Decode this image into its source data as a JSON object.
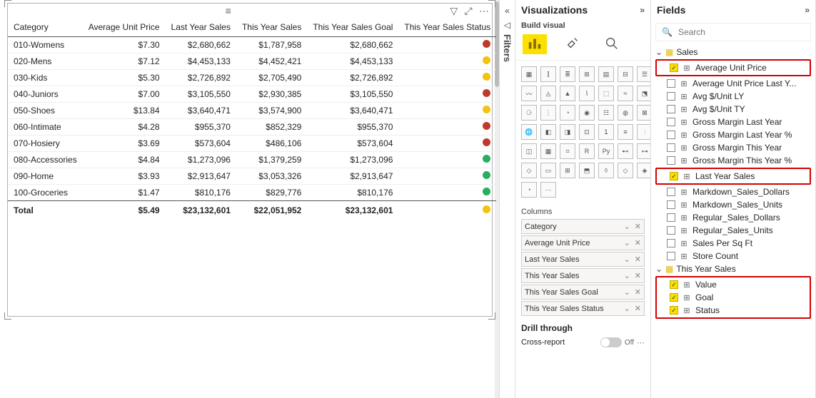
{
  "visual": {
    "toolbar_center_icon": "≡",
    "toolbar_filter_icon": "⧩",
    "toolbar_focus_icon": "⤢",
    "toolbar_more_icon": "⋯"
  },
  "table": {
    "headers": [
      "Category",
      "Average Unit Price",
      "Last Year Sales",
      "This Year Sales",
      "This Year Sales Goal",
      "This Year Sales Status"
    ],
    "rows": [
      {
        "c": "010-Womens",
        "aup": "$7.30",
        "ly": "$2,680,662",
        "ty": "$1,787,958",
        "goal": "$2,680,662",
        "status": "red"
      },
      {
        "c": "020-Mens",
        "aup": "$7.12",
        "ly": "$4,453,133",
        "ty": "$4,452,421",
        "goal": "$4,453,133",
        "status": "yellow"
      },
      {
        "c": "030-Kids",
        "aup": "$5.30",
        "ly": "$2,726,892",
        "ty": "$2,705,490",
        "goal": "$2,726,892",
        "status": "yellow"
      },
      {
        "c": "040-Juniors",
        "aup": "$7.00",
        "ly": "$3,105,550",
        "ty": "$2,930,385",
        "goal": "$3,105,550",
        "status": "red"
      },
      {
        "c": "050-Shoes",
        "aup": "$13.84",
        "ly": "$3,640,471",
        "ty": "$3,574,900",
        "goal": "$3,640,471",
        "status": "yellow"
      },
      {
        "c": "060-Intimate",
        "aup": "$4.28",
        "ly": "$955,370",
        "ty": "$852,329",
        "goal": "$955,370",
        "status": "red"
      },
      {
        "c": "070-Hosiery",
        "aup": "$3.69",
        "ly": "$573,604",
        "ty": "$486,106",
        "goal": "$573,604",
        "status": "red"
      },
      {
        "c": "080-Accessories",
        "aup": "$4.84",
        "ly": "$1,273,096",
        "ty": "$1,379,259",
        "goal": "$1,273,096",
        "status": "green"
      },
      {
        "c": "090-Home",
        "aup": "$3.93",
        "ly": "$2,913,647",
        "ty": "$3,053,326",
        "goal": "$2,913,647",
        "status": "green"
      },
      {
        "c": "100-Groceries",
        "aup": "$1.47",
        "ly": "$810,176",
        "ty": "$829,776",
        "goal": "$810,176",
        "status": "green"
      }
    ],
    "total_label": "Total",
    "total": {
      "aup": "$5.49",
      "ly": "$23,132,601",
      "ty": "$22,051,952",
      "goal": "$23,132,601",
      "status": "yellow"
    }
  },
  "status_colors": {
    "red": "#c0392b",
    "yellow": "#f1c40f",
    "green": "#27ae60"
  },
  "filters_tab": {
    "label": "Filters"
  },
  "viz": {
    "pane_title": "Visualizations",
    "sub": "Build visual",
    "tabs": [
      "build",
      "format",
      "analytics"
    ],
    "columns_label": "Columns",
    "wells": [
      "Category",
      "Average Unit Price",
      "Last Year Sales",
      "This Year Sales",
      "This Year Sales Goal",
      "This Year Sales Status"
    ],
    "drill_label": "Drill through",
    "cross_label": "Cross-report",
    "cross_state": "Off"
  },
  "fields": {
    "pane_title": "Fields",
    "search_placeholder": "Search",
    "table1": "Sales",
    "table1_fields": [
      {
        "name": "Average Unit Price",
        "checked": true,
        "calc": true,
        "hl": true
      },
      {
        "name": "Average Unit Price Last Y...",
        "checked": false,
        "calc": true
      },
      {
        "name": "Avg $/Unit LY",
        "checked": false,
        "calc": true
      },
      {
        "name": "Avg $/Unit TY",
        "checked": false,
        "calc": true
      },
      {
        "name": "Gross Margin Last Year",
        "checked": false,
        "calc": true
      },
      {
        "name": "Gross Margin Last Year %",
        "checked": false,
        "calc": true
      },
      {
        "name": "Gross Margin This Year",
        "checked": false,
        "calc": true
      },
      {
        "name": "Gross Margin This Year %",
        "checked": false,
        "calc": true
      },
      {
        "name": "Last Year Sales",
        "checked": true,
        "calc": true,
        "hl": true
      },
      {
        "name": "Markdown_Sales_Dollars",
        "checked": false,
        "calc": true
      },
      {
        "name": "Markdown_Sales_Units",
        "checked": false,
        "calc": true
      },
      {
        "name": "Regular_Sales_Dollars",
        "checked": false,
        "calc": true
      },
      {
        "name": "Regular_Sales_Units",
        "checked": false,
        "calc": true
      },
      {
        "name": "Sales Per Sq Ft",
        "checked": false,
        "calc": true
      },
      {
        "name": "Store Count",
        "checked": false,
        "calc": true
      }
    ],
    "table2": "This Year Sales",
    "table2_fields": [
      {
        "name": "Value",
        "checked": true,
        "calc": true
      },
      {
        "name": "Goal",
        "checked": true,
        "calc": true
      },
      {
        "name": "Status",
        "checked": true,
        "calc": true
      }
    ]
  }
}
